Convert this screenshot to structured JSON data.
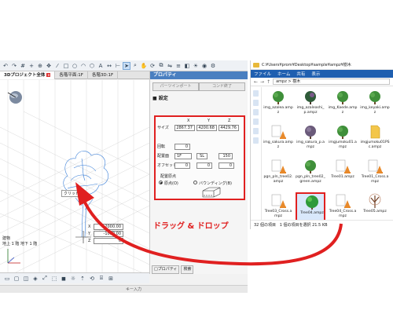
{
  "cad": {
    "tabs": [
      {
        "label": "3Dプロジェクト全体",
        "active": true
      },
      {
        "label": "各階平面:1F",
        "active": false
      },
      {
        "label": "各階3D:1F",
        "active": false
      }
    ],
    "object_label": "クリッド",
    "coords": {
      "x": "-2000.00",
      "y": "-1000.00",
      "z": "0"
    },
    "layer_lines": [
      "建物",
      "地上 1 階  地下 1 階"
    ],
    "key_input": "キー入力"
  },
  "properties": {
    "title": "プロパティ",
    "sub_tabs": [
      "パーツインポート",
      "コンド終了"
    ],
    "section": "設定",
    "size": {
      "label": "サイズ",
      "headers": [
        "X",
        "Y",
        "Z"
      ],
      "values": [
        "2867.37",
        "4200.68",
        "4429.76"
      ]
    },
    "rotation": {
      "label": "回転",
      "value": "0"
    },
    "placement": {
      "label": "配置面",
      "select": "1F",
      "mode": "SL",
      "height": "150"
    },
    "offset": {
      "label": "オフセット",
      "values": [
        "0",
        "0",
        "0"
      ]
    },
    "origin": {
      "label": "配置原点",
      "options": [
        "原点(O)",
        "バウンディング(B)"
      ]
    },
    "bottom_buttons": [
      "□プロパティ",
      "検索"
    ]
  },
  "explorer": {
    "title": "C:¥Users¥prom¥Desktop¥sample¥ampz¥樹木",
    "ribbon": [
      "ファイル",
      "ホーム",
      "共有",
      "表示"
    ],
    "path": "ampz  >  樹木",
    "files": [
      {
        "name": "img_azalea.ampz",
        "kind": "green-tree"
      },
      {
        "name": "img_azaleashi_p.ampz",
        "kind": "dark-tree"
      },
      {
        "name": "img_Kaede.ampz",
        "kind": "green-tree"
      },
      {
        "name": "img_keyaki.ampz",
        "kind": "green-tree"
      },
      {
        "name": "img_sakura.ampz",
        "kind": "cone"
      },
      {
        "name": "img_sakura_p.ampz",
        "kind": "pink-tree"
      },
      {
        "name": "imgjumoku01.ampz",
        "kind": "green-tree"
      },
      {
        "name": "imgjumoku01PSc.ampz",
        "kind": "doc"
      },
      {
        "name": "pgn_pln_tree02.ampz",
        "kind": "cone"
      },
      {
        "name": "pgn_pln_tree02_green.ampz",
        "kind": "green-tree"
      },
      {
        "name": "Tree01.ampz",
        "kind": "cone"
      },
      {
        "name": "Tree01_Cross.ampz",
        "kind": "cone"
      },
      {
        "name": "Tree03_Cross.ampz",
        "kind": "cone"
      },
      {
        "name": "Tree04.ampz",
        "kind": "bright-tree",
        "selected": true
      },
      {
        "name": "Tree04_Cross.ampz",
        "kind": "cone"
      },
      {
        "name": "Tree05.ampz",
        "kind": "bare-tree"
      }
    ],
    "status": {
      "count": "32 個の項目",
      "selection": "1 個の項目を選択  21.5 KB"
    }
  },
  "overlay": {
    "drag_label": "ドラッグ & ドロップ"
  },
  "colors": {
    "accent_red": "#e02020",
    "ribbon_blue": "#1f5fb0",
    "panel_blue": "#4a7fc0"
  }
}
